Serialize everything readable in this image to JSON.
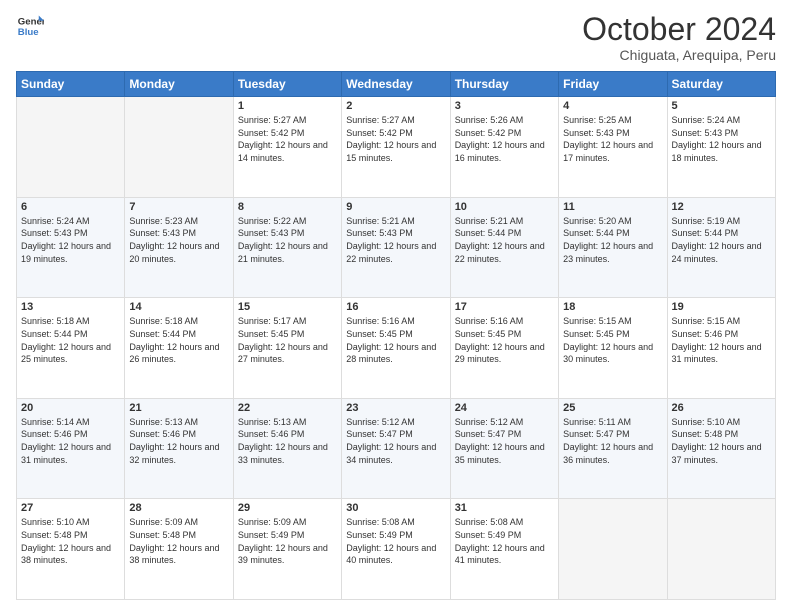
{
  "header": {
    "logo_line1": "General",
    "logo_line2": "Blue",
    "month_title": "October 2024",
    "location": "Chiguata, Arequipa, Peru"
  },
  "weekdays": [
    "Sunday",
    "Monday",
    "Tuesday",
    "Wednesday",
    "Thursday",
    "Friday",
    "Saturday"
  ],
  "weeks": [
    [
      {
        "day": "",
        "sunrise": "",
        "sunset": "",
        "daylight": ""
      },
      {
        "day": "",
        "sunrise": "",
        "sunset": "",
        "daylight": ""
      },
      {
        "day": "1",
        "sunrise": "Sunrise: 5:27 AM",
        "sunset": "Sunset: 5:42 PM",
        "daylight": "Daylight: 12 hours and 14 minutes."
      },
      {
        "day": "2",
        "sunrise": "Sunrise: 5:27 AM",
        "sunset": "Sunset: 5:42 PM",
        "daylight": "Daylight: 12 hours and 15 minutes."
      },
      {
        "day": "3",
        "sunrise": "Sunrise: 5:26 AM",
        "sunset": "Sunset: 5:42 PM",
        "daylight": "Daylight: 12 hours and 16 minutes."
      },
      {
        "day": "4",
        "sunrise": "Sunrise: 5:25 AM",
        "sunset": "Sunset: 5:43 PM",
        "daylight": "Daylight: 12 hours and 17 minutes."
      },
      {
        "day": "5",
        "sunrise": "Sunrise: 5:24 AM",
        "sunset": "Sunset: 5:43 PM",
        "daylight": "Daylight: 12 hours and 18 minutes."
      }
    ],
    [
      {
        "day": "6",
        "sunrise": "Sunrise: 5:24 AM",
        "sunset": "Sunset: 5:43 PM",
        "daylight": "Daylight: 12 hours and 19 minutes."
      },
      {
        "day": "7",
        "sunrise": "Sunrise: 5:23 AM",
        "sunset": "Sunset: 5:43 PM",
        "daylight": "Daylight: 12 hours and 20 minutes."
      },
      {
        "day": "8",
        "sunrise": "Sunrise: 5:22 AM",
        "sunset": "Sunset: 5:43 PM",
        "daylight": "Daylight: 12 hours and 21 minutes."
      },
      {
        "day": "9",
        "sunrise": "Sunrise: 5:21 AM",
        "sunset": "Sunset: 5:43 PM",
        "daylight": "Daylight: 12 hours and 22 minutes."
      },
      {
        "day": "10",
        "sunrise": "Sunrise: 5:21 AM",
        "sunset": "Sunset: 5:44 PM",
        "daylight": "Daylight: 12 hours and 22 minutes."
      },
      {
        "day": "11",
        "sunrise": "Sunrise: 5:20 AM",
        "sunset": "Sunset: 5:44 PM",
        "daylight": "Daylight: 12 hours and 23 minutes."
      },
      {
        "day": "12",
        "sunrise": "Sunrise: 5:19 AM",
        "sunset": "Sunset: 5:44 PM",
        "daylight": "Daylight: 12 hours and 24 minutes."
      }
    ],
    [
      {
        "day": "13",
        "sunrise": "Sunrise: 5:18 AM",
        "sunset": "Sunset: 5:44 PM",
        "daylight": "Daylight: 12 hours and 25 minutes."
      },
      {
        "day": "14",
        "sunrise": "Sunrise: 5:18 AM",
        "sunset": "Sunset: 5:44 PM",
        "daylight": "Daylight: 12 hours and 26 minutes."
      },
      {
        "day": "15",
        "sunrise": "Sunrise: 5:17 AM",
        "sunset": "Sunset: 5:45 PM",
        "daylight": "Daylight: 12 hours and 27 minutes."
      },
      {
        "day": "16",
        "sunrise": "Sunrise: 5:16 AM",
        "sunset": "Sunset: 5:45 PM",
        "daylight": "Daylight: 12 hours and 28 minutes."
      },
      {
        "day": "17",
        "sunrise": "Sunrise: 5:16 AM",
        "sunset": "Sunset: 5:45 PM",
        "daylight": "Daylight: 12 hours and 29 minutes."
      },
      {
        "day": "18",
        "sunrise": "Sunrise: 5:15 AM",
        "sunset": "Sunset: 5:45 PM",
        "daylight": "Daylight: 12 hours and 30 minutes."
      },
      {
        "day": "19",
        "sunrise": "Sunrise: 5:15 AM",
        "sunset": "Sunset: 5:46 PM",
        "daylight": "Daylight: 12 hours and 31 minutes."
      }
    ],
    [
      {
        "day": "20",
        "sunrise": "Sunrise: 5:14 AM",
        "sunset": "Sunset: 5:46 PM",
        "daylight": "Daylight: 12 hours and 31 minutes."
      },
      {
        "day": "21",
        "sunrise": "Sunrise: 5:13 AM",
        "sunset": "Sunset: 5:46 PM",
        "daylight": "Daylight: 12 hours and 32 minutes."
      },
      {
        "day": "22",
        "sunrise": "Sunrise: 5:13 AM",
        "sunset": "Sunset: 5:46 PM",
        "daylight": "Daylight: 12 hours and 33 minutes."
      },
      {
        "day": "23",
        "sunrise": "Sunrise: 5:12 AM",
        "sunset": "Sunset: 5:47 PM",
        "daylight": "Daylight: 12 hours and 34 minutes."
      },
      {
        "day": "24",
        "sunrise": "Sunrise: 5:12 AM",
        "sunset": "Sunset: 5:47 PM",
        "daylight": "Daylight: 12 hours and 35 minutes."
      },
      {
        "day": "25",
        "sunrise": "Sunrise: 5:11 AM",
        "sunset": "Sunset: 5:47 PM",
        "daylight": "Daylight: 12 hours and 36 minutes."
      },
      {
        "day": "26",
        "sunrise": "Sunrise: 5:10 AM",
        "sunset": "Sunset: 5:48 PM",
        "daylight": "Daylight: 12 hours and 37 minutes."
      }
    ],
    [
      {
        "day": "27",
        "sunrise": "Sunrise: 5:10 AM",
        "sunset": "Sunset: 5:48 PM",
        "daylight": "Daylight: 12 hours and 38 minutes."
      },
      {
        "day": "28",
        "sunrise": "Sunrise: 5:09 AM",
        "sunset": "Sunset: 5:48 PM",
        "daylight": "Daylight: 12 hours and 38 minutes."
      },
      {
        "day": "29",
        "sunrise": "Sunrise: 5:09 AM",
        "sunset": "Sunset: 5:49 PM",
        "daylight": "Daylight: 12 hours and 39 minutes."
      },
      {
        "day": "30",
        "sunrise": "Sunrise: 5:08 AM",
        "sunset": "Sunset: 5:49 PM",
        "daylight": "Daylight: 12 hours and 40 minutes."
      },
      {
        "day": "31",
        "sunrise": "Sunrise: 5:08 AM",
        "sunset": "Sunset: 5:49 PM",
        "daylight": "Daylight: 12 hours and 41 minutes."
      },
      {
        "day": "",
        "sunrise": "",
        "sunset": "",
        "daylight": ""
      },
      {
        "day": "",
        "sunrise": "",
        "sunset": "",
        "daylight": ""
      }
    ]
  ]
}
